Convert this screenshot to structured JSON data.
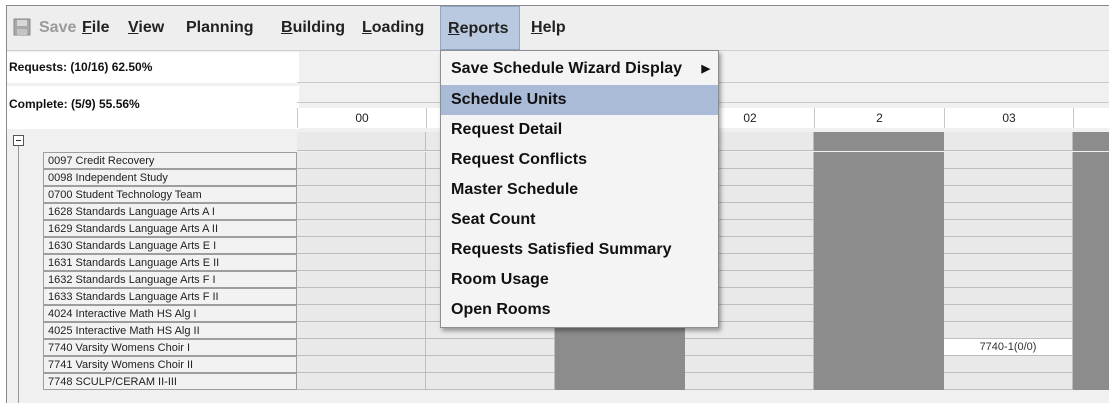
{
  "menubar": {
    "items": [
      {
        "label": "Save",
        "disabled": true
      },
      {
        "label": "File"
      },
      {
        "label": "View"
      },
      {
        "label": "Planning"
      },
      {
        "label": "Building"
      },
      {
        "label": "Loading"
      },
      {
        "label": "Reports",
        "active": true
      },
      {
        "label": "Help"
      }
    ]
  },
  "stats": {
    "requests": "Requests: (10/16) 62.50%",
    "complete": "Complete: (5/9) 55.56%"
  },
  "columns": [
    "00",
    "",
    "",
    "02",
    "2",
    "03",
    ""
  ],
  "courses": [
    "0097 Credit Recovery",
    "0098 Independent Study",
    "0700 Student Technology Team",
    "1628 Standards Language Arts A I",
    "1629 Standards Language Arts A II",
    "1630 Standards Language Arts E I",
    "1631 Standards Language Arts E II",
    "1632 Standards Language Arts F I",
    "1633 Standards Language Arts F II",
    "4024 Interactive Math HS Alg I",
    "4025 Interactive Math HS Alg II",
    "7740 Varsity Womens Choir I",
    "7741 Varsity Womens Choir II",
    "7748 SCULP/CERAM II-III"
  ],
  "cell_values": {
    "7740-col6": "7740-1(0/0)"
  },
  "reports_menu": {
    "items": [
      {
        "label": "Save Schedule Wizard Display",
        "submenu": true
      },
      {
        "label": "Schedule Units",
        "highlighted": true
      },
      {
        "label": "Request Detail"
      },
      {
        "label": "Request Conflicts"
      },
      {
        "label": "Master Schedule"
      },
      {
        "label": "Seat Count"
      },
      {
        "label": "Requests Satisfied Summary"
      },
      {
        "label": "Room Usage"
      },
      {
        "label": "Open Rooms"
      }
    ]
  },
  "colors": {
    "menu_highlight": "#a9bbd6",
    "dark_cell": "#8c8c8c",
    "light_cell": "#e9e9e9"
  }
}
